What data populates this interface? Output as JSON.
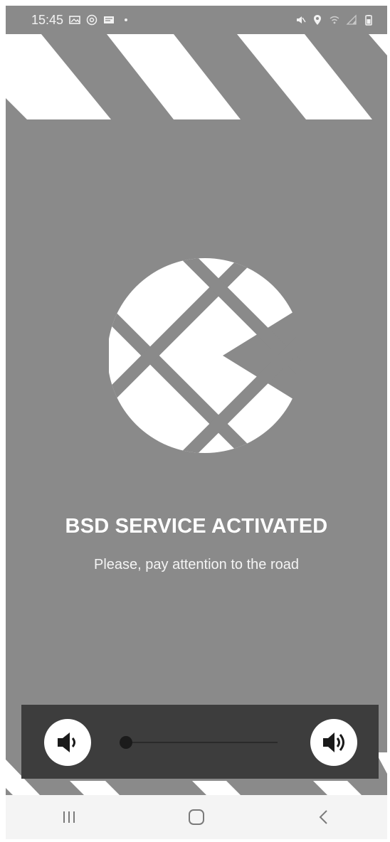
{
  "status_bar": {
    "time": "15:45",
    "left_icons": [
      "gallery-icon",
      "at-icon",
      "message-icon",
      "dot-icon"
    ],
    "right_icons": [
      "mute-icon",
      "location-icon",
      "wifi-icon",
      "signal-icon",
      "battery-icon"
    ]
  },
  "main": {
    "logo_icon": "c-logo-icon",
    "headline": "BSD SERVICE ACTIVATED",
    "subline": "Please, pay attention to the road"
  },
  "volume": {
    "down_icon": "volume-down-icon",
    "up_icon": "volume-up-icon",
    "level": 0.04
  },
  "nav": {
    "recents_icon": "recents-icon",
    "home_icon": "home-icon",
    "back_icon": "back-icon"
  },
  "colors": {
    "background": "#8a8a8a",
    "panel": "#3d3d3d",
    "stripe": "#ffffff"
  }
}
